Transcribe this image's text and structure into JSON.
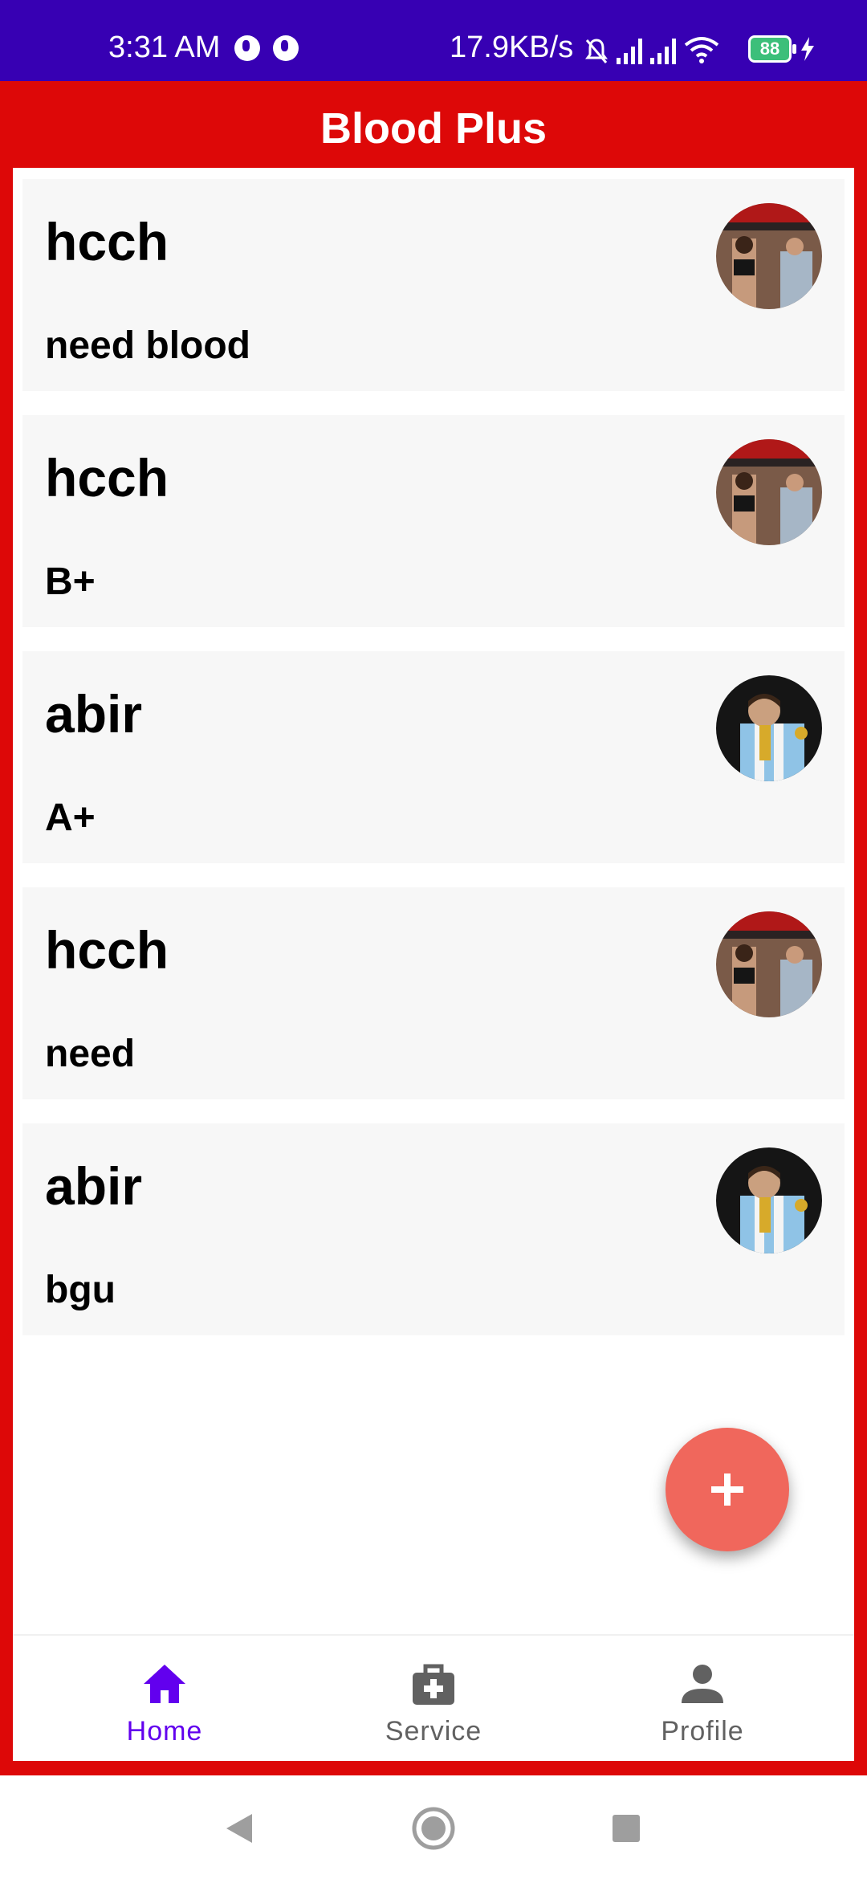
{
  "status_bar": {
    "time": "3:31 AM",
    "network_speed": "17.9KB/s",
    "battery_level": "88",
    "background_color": "#3700b3"
  },
  "app_bar": {
    "title": "Blood Plus",
    "color": "#dd0808"
  },
  "posts": [
    {
      "name": "hcch",
      "message": "need blood",
      "avatar": "avatar-photo-couple"
    },
    {
      "name": "hcch",
      "message": "B+",
      "avatar": "avatar-photo-couple"
    },
    {
      "name": "abir",
      "message": "A+",
      "avatar": "avatar-photo-footballer"
    },
    {
      "name": "hcch",
      "message": "need",
      "avatar": "avatar-photo-couple"
    },
    {
      "name": "abir",
      "message": "bgu",
      "avatar": "avatar-photo-footballer"
    }
  ],
  "fab": {
    "icon": "plus-icon",
    "color": "#f0675c"
  },
  "bottom_nav": {
    "items": [
      {
        "label": "Home",
        "icon": "home-icon",
        "active": true
      },
      {
        "label": "Service",
        "icon": "medical-bag-icon",
        "active": false
      },
      {
        "label": "Profile",
        "icon": "person-icon",
        "active": false
      }
    ],
    "active_color": "#6200ee",
    "inactive_color": "#616161"
  },
  "system_nav": {
    "buttons": [
      "back-icon",
      "home-circle-icon",
      "recents-icon"
    ]
  }
}
